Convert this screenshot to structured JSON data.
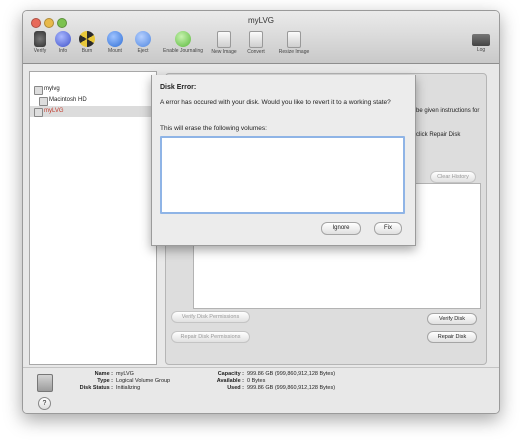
{
  "window": {
    "title": "myLVG"
  },
  "toolbar": {
    "items": [
      {
        "label": "Verify",
        "icon": "microscope-icon"
      },
      {
        "label": "Info",
        "icon": "info-icon"
      },
      {
        "label": "Burn",
        "icon": "radioactive-icon"
      },
      {
        "label": "Mount",
        "icon": "mount-icon"
      },
      {
        "label": "Eject",
        "icon": "eject-icon"
      },
      {
        "label": "Enable Journaling",
        "icon": "journal-icon"
      },
      {
        "label": "New Image",
        "icon": "new-image-icon"
      },
      {
        "label": "Convert",
        "icon": "convert-icon"
      },
      {
        "label": "Resize Image",
        "icon": "resize-image-icon"
      },
      {
        "label": "Log",
        "icon": "log-icon"
      }
    ]
  },
  "sidebar": {
    "items": [
      {
        "label": "mylvg"
      },
      {
        "label": "Macintosh HD"
      },
      {
        "label": "myLVG"
      }
    ]
  },
  "panel": {
    "instructions_right_1": "be given instructions for",
    "instructions_right_2": "click Repair Disk",
    "clear_history": "Clear History",
    "verify_permissions": "Verify Disk Permissions",
    "repair_permissions": "Repair Disk Permissions",
    "verify_disk": "Verify Disk",
    "repair_disk": "Repair Disk"
  },
  "info": {
    "name_label": "Name :",
    "name_value": "myLVG",
    "type_label": "Type :",
    "type_value": "Logical Volume Group",
    "status_label": "Disk Status :",
    "status_value": "Initializing",
    "capacity_label": "Capacity :",
    "capacity_value": "999.86 GB (999,860,912,128 Bytes)",
    "available_label": "Available :",
    "available_value": "0 Bytes",
    "used_label": "Used :",
    "used_value": "999.86 GB (999,860,912,128 Bytes)",
    "help": "?"
  },
  "dialog": {
    "title": "Disk Error:",
    "message": "A error has occured with your disk. Would you like to revert it to a working state?",
    "subtext": "This will erase the following volumes:",
    "ignore": "Ignore",
    "fix": "Fix"
  },
  "colors": {
    "selected_text": "#c0392b",
    "focus_ring": "#8fb4e6"
  }
}
